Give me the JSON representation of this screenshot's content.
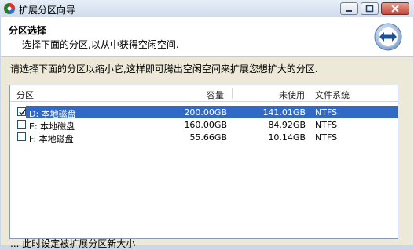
{
  "window": {
    "title": "扩展分区向导"
  },
  "header": {
    "title": "分区选择",
    "subtitle": "选择下面的分区,以从中获得空闲空间."
  },
  "instruction": "请选择下面的分区以缩小它,这样即可腾出空闲空间来扩展您想扩大的分区.",
  "table": {
    "columns": [
      "分区",
      "容量",
      "未使用",
      "文件系统"
    ],
    "rows": [
      {
        "checked": true,
        "name": "D: 本地磁盘",
        "capacity": "200.00GB",
        "unused": "141.01GB",
        "fs": "NTFS",
        "selected": true
      },
      {
        "checked": false,
        "name": "E: 本地磁盘",
        "capacity": "160.00GB",
        "unused": "84.92GB",
        "fs": "NTFS",
        "selected": false
      },
      {
        "checked": false,
        "name": "F: 本地磁盘",
        "capacity": "55.66GB",
        "unused": "10.14GB",
        "fs": "NTFS",
        "selected": false
      }
    ]
  },
  "footer": "... 此时设定被扩展分区新大小",
  "colors": {
    "selection": "#3169c6",
    "header_bg": "#ffffff",
    "body_bg": "#ece9d8"
  }
}
